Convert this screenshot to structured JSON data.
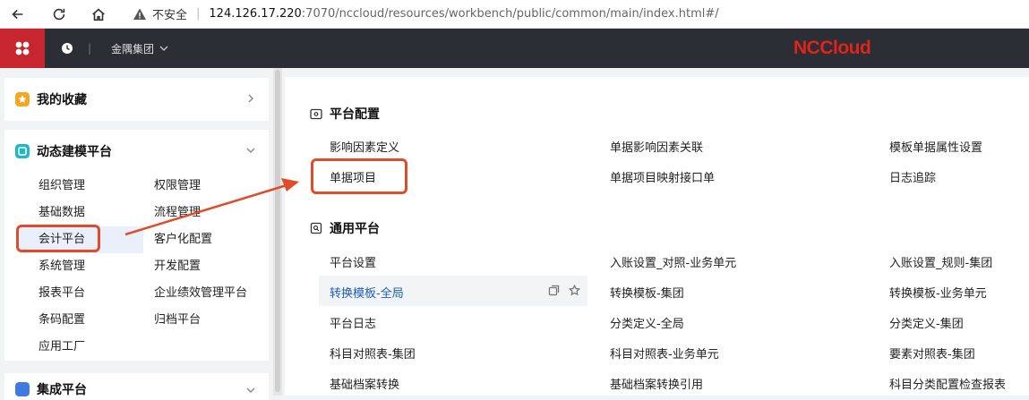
{
  "browser": {
    "insecure_label": "不安全",
    "url_host": "124.126.17.220",
    "url_path": ":7070/nccloud/resources/workbench/public/common/main/index.html#/"
  },
  "header": {
    "group": "金隅集团",
    "separator": "|",
    "brand": "NCCloud"
  },
  "sidebar": {
    "favorites": {
      "title": "我的收藏"
    },
    "dynamic": {
      "title": "动态建模平台",
      "left_items": [
        "组织管理",
        "基础数据",
        "会计平台",
        "系统管理",
        "报表平台",
        "条码配置",
        "应用工厂"
      ],
      "right_items": [
        "权限管理",
        "流程管理",
        "客户化配置",
        "开发配置",
        "企业绩效管理平台",
        "归档平台"
      ]
    },
    "integration": {
      "title": "集成平台"
    }
  },
  "main": {
    "platform_config": {
      "title": "平台配置",
      "rows": [
        [
          "影响因素定义",
          "单据影响因素关联",
          "模板单据属性设置"
        ],
        [
          "单据项目",
          "单据项目映射接口单",
          "日志追踪"
        ]
      ]
    },
    "general_platform": {
      "title": "通用平台",
      "rows": [
        [
          "平台设置",
          "入账设置_对照-业务单元",
          "入账设置_规则-集团"
        ],
        [
          "转换模板-全局",
          "转换模板-集团",
          "转换模板-业务单元"
        ],
        [
          "平台日志",
          "分类定义-全局",
          "分类定义-集团"
        ],
        [
          "科目对照表-集团",
          "科目对照表-业务单元",
          "要素对照表-集团"
        ],
        [
          "基础档案转换",
          "基础档案转换引用",
          "科目分类配置检查报表"
        ]
      ]
    }
  },
  "colors": {
    "header_bg": "#2b2e35",
    "logo_bg": "#c8262f",
    "brand": "#e2231a",
    "annotation": "#e04c2a",
    "link_active": "#1a5fb4"
  }
}
